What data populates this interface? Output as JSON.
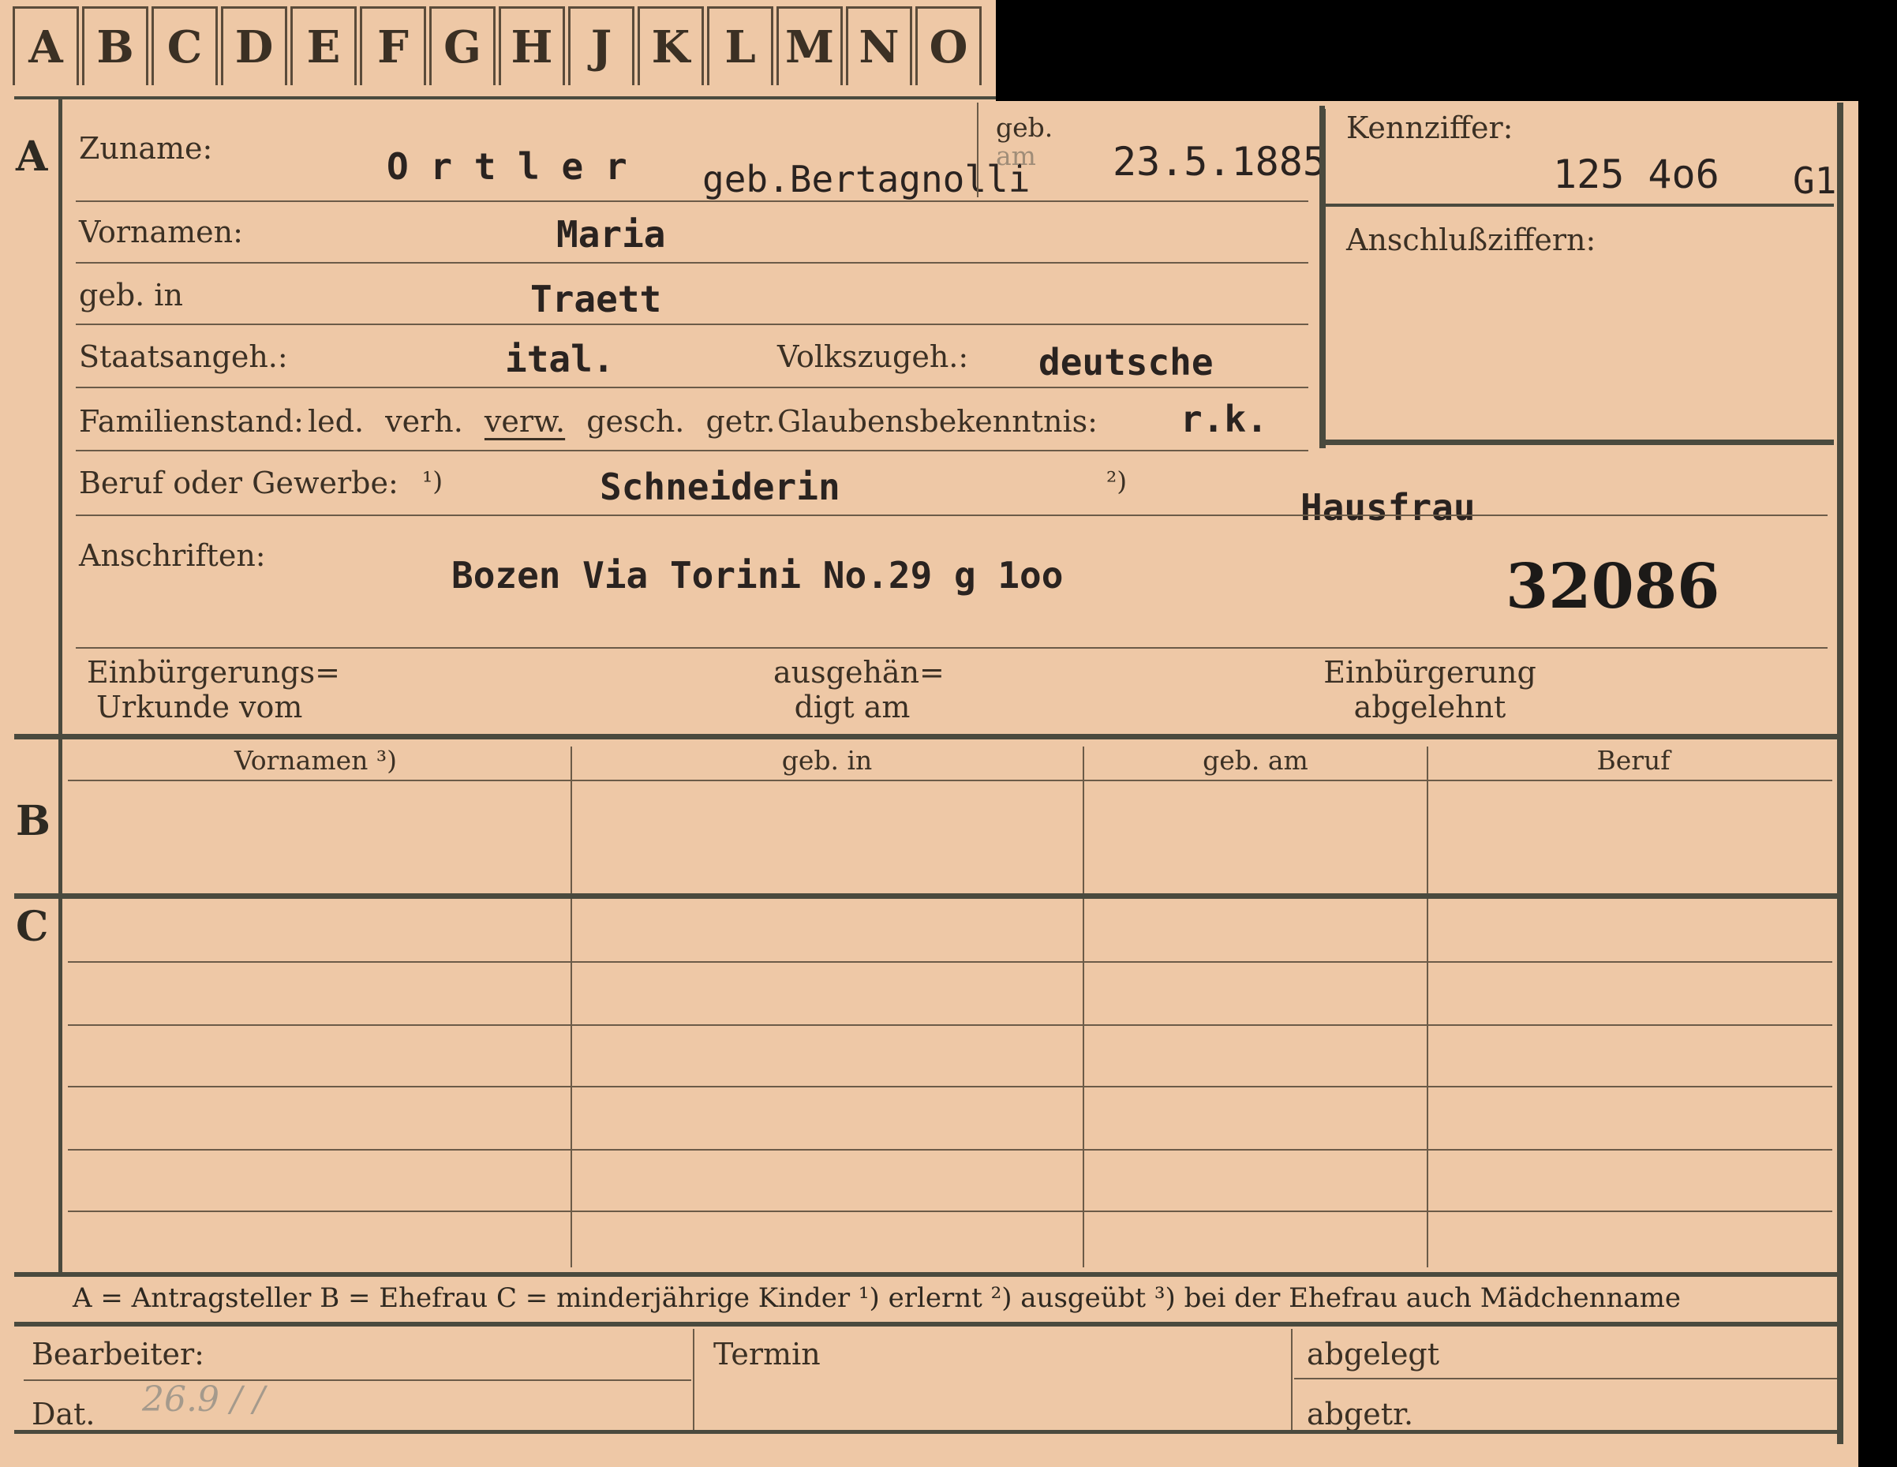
{
  "tabs": [
    "A",
    "B",
    "C",
    "D",
    "E",
    "F",
    "G",
    "H",
    "J",
    "K",
    "L",
    "M",
    "N",
    "O"
  ],
  "section_a": {
    "marker": "A",
    "zuname_label": "Zuname:",
    "zuname_value": "O r t l e r",
    "geb_name": "geb.Bertagnolli",
    "geb_am_label_1": "geb.",
    "geb_am_label_2": "am",
    "geb_am_value": "23.5.1885",
    "vornamen_label": "Vornamen:",
    "vornamen_value": "Maria",
    "geb_in_label": "geb. in",
    "geb_in_value": "Traett",
    "staatsangeh_label": "Staatsangeh.:",
    "staatsangeh_value": "ital.",
    "volkszugeh_label": "Volkszugeh.:",
    "volkszugeh_value": "deutsche",
    "familienstand_label": "Familienstand:",
    "familienstand_options": [
      "led.",
      "verh.",
      "verw.",
      "gesch.",
      "getr."
    ],
    "familienstand_selected": "verw.",
    "glaubens_label": "Glaubensbekenntnis:",
    "glaubens_value": "r.k.",
    "beruf_label": "Beruf oder Gewerbe:",
    "beruf_mark_1": "¹)",
    "beruf_mark_2": "²)",
    "beruf_value_1": "Schneiderin",
    "beruf_value_2": "Hausfrau",
    "anschriften_label": "Anschriften:",
    "anschriften_value": "Bozen Via Torini No.29 g 1oo",
    "card_number": "32086",
    "kennziffer_label": "Kennziffer:",
    "kennziffer_value": "125 4o6",
    "kennziffer_suffix": "G1",
    "anschluss_label": "Anschlußziffern:",
    "einb_urkunde_1": "Einbürgerungs=",
    "einb_urkunde_2": "Urkunde vom",
    "ausgehaen_1": "ausgehän=",
    "ausgehaen_2": "digt am",
    "einb_abgelehnt_1": "Einbürgerung",
    "einb_abgelehnt_2": "abgelehnt"
  },
  "section_b": {
    "marker": "B",
    "columns": [
      "Vornamen ³)",
      "geb. in",
      "geb. am",
      "Beruf"
    ]
  },
  "section_c": {
    "marker": "C"
  },
  "legend": "A = Antragsteller   B = Ehefrau   C = minderjährige Kinder   ¹) erlernt   ²) ausgeübt   ³) bei der Ehefrau auch Mädchenname",
  "footer": {
    "bearbeiter_label": "Bearbeiter:",
    "dat_label": "Dat.",
    "dat_value": "26.9 /          /",
    "termin_label": "Termin",
    "abgelegt_label": "abgelegt",
    "abgetr_label": "abgetr."
  }
}
